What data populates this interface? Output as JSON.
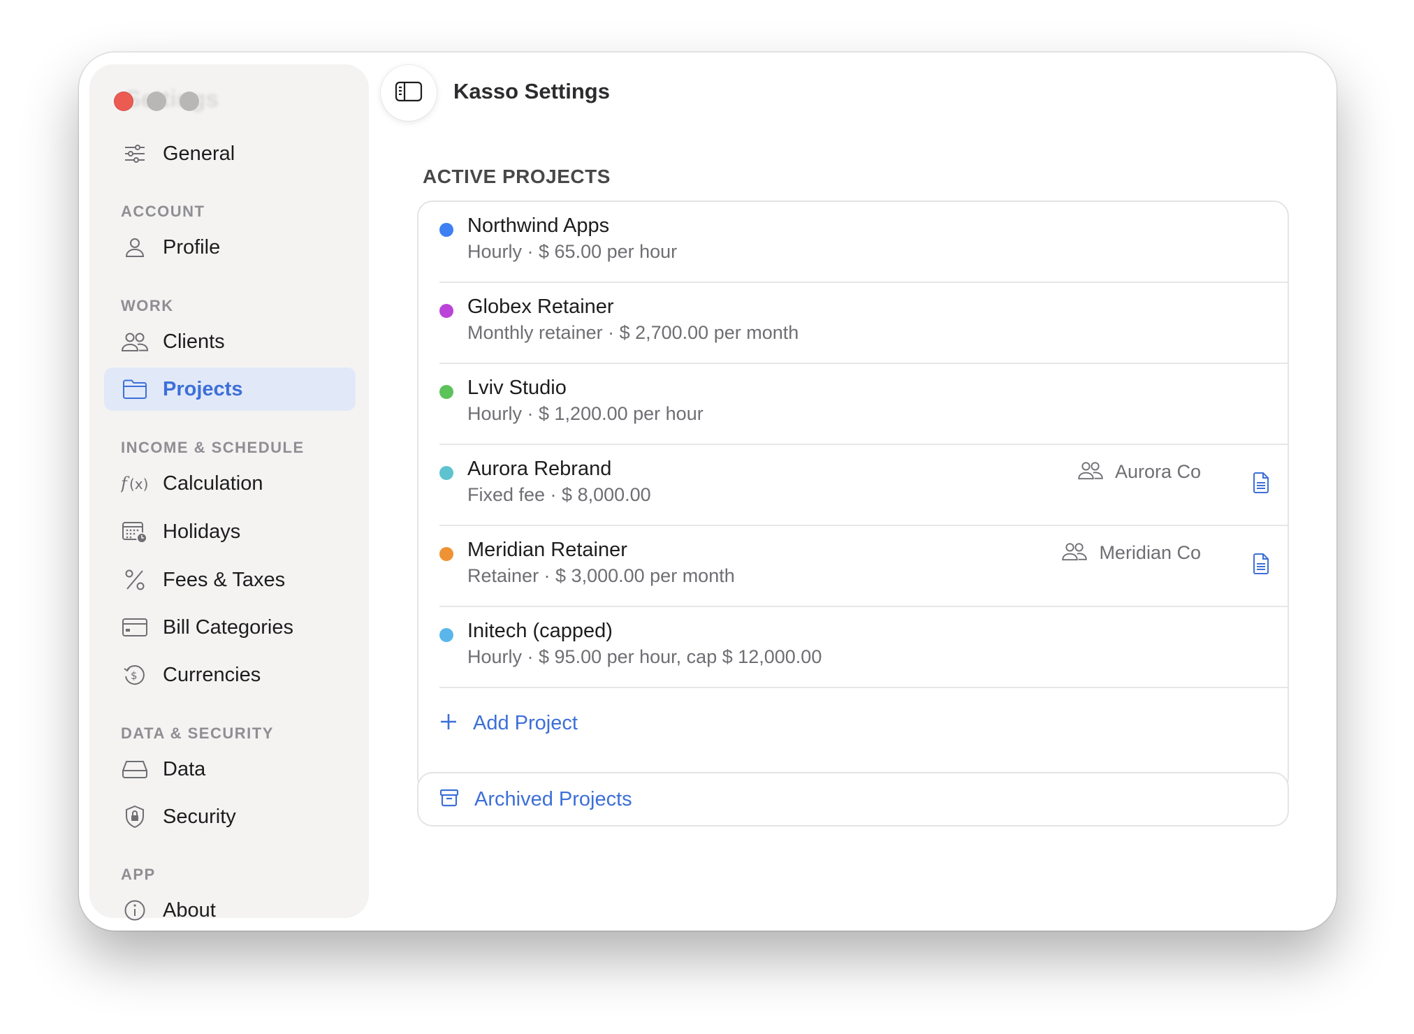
{
  "window": {
    "title": "Kasso Settings",
    "sidebar_ghost_title": "Settings"
  },
  "sidebar": {
    "items": [
      {
        "id": "general",
        "label": "General",
        "icon": "sliders-icon"
      },
      {
        "id": "profile",
        "label": "Profile",
        "icon": "person-icon"
      },
      {
        "id": "clients",
        "label": "Clients",
        "icon": "people-icon"
      },
      {
        "id": "projects",
        "label": "Projects",
        "icon": "folder-icon",
        "active": true
      },
      {
        "id": "calculation",
        "label": "Calculation",
        "icon": "function-icon"
      },
      {
        "id": "holidays",
        "label": "Holidays",
        "icon": "calendar-clock-icon"
      },
      {
        "id": "fees",
        "label": "Fees & Taxes",
        "icon": "percent-icon"
      },
      {
        "id": "bill_categories",
        "label": "Bill Categories",
        "icon": "credit-card-icon"
      },
      {
        "id": "currencies",
        "label": "Currencies",
        "icon": "currency-exchange-icon"
      },
      {
        "id": "data",
        "label": "Data",
        "icon": "drive-icon"
      },
      {
        "id": "security",
        "label": "Security",
        "icon": "shield-lock-icon"
      },
      {
        "id": "about",
        "label": "About",
        "icon": "info-icon"
      }
    ],
    "sections": {
      "account": "ACCOUNT",
      "work": "WORK",
      "income": "INCOME & SCHEDULE",
      "data_security": "DATA & SECURITY",
      "app": "APP"
    }
  },
  "main": {
    "section_title": "ACTIVE PROJECTS",
    "projects": [
      {
        "name": "Northwind Apps",
        "detail": "Hourly · $ 65.00 per hour",
        "color": "#3e7ff3",
        "client": null
      },
      {
        "name": "Globex Retainer",
        "detail": "Monthly retainer · $ 2,700.00 per month",
        "color": "#bb43d8",
        "client": null
      },
      {
        "name": "Lviv Studio",
        "detail": "Hourly · $ 1,200.00 per hour",
        "color": "#5cc25a",
        "client": null
      },
      {
        "name": "Aurora Rebrand",
        "detail": "Fixed fee · $ 8,000.00",
        "color": "#5ec3cf",
        "client": "Aurora Co"
      },
      {
        "name": "Meridian Retainer",
        "detail": "Retainer · $ 3,000.00 per month",
        "color": "#ef9235",
        "client": "Meridian Co"
      },
      {
        "name": "Initech (capped)",
        "detail": "Hourly · $ 95.00 per hour, cap $ 12,000.00",
        "color": "#5ab6ea",
        "client": null
      }
    ],
    "add_project_label": "Add Project",
    "archived_label": "Archived Projects"
  },
  "colors": {
    "accent": "#3d6fd8",
    "close": "#ec5b52",
    "sidebar_bg": "#f4f3f2"
  }
}
